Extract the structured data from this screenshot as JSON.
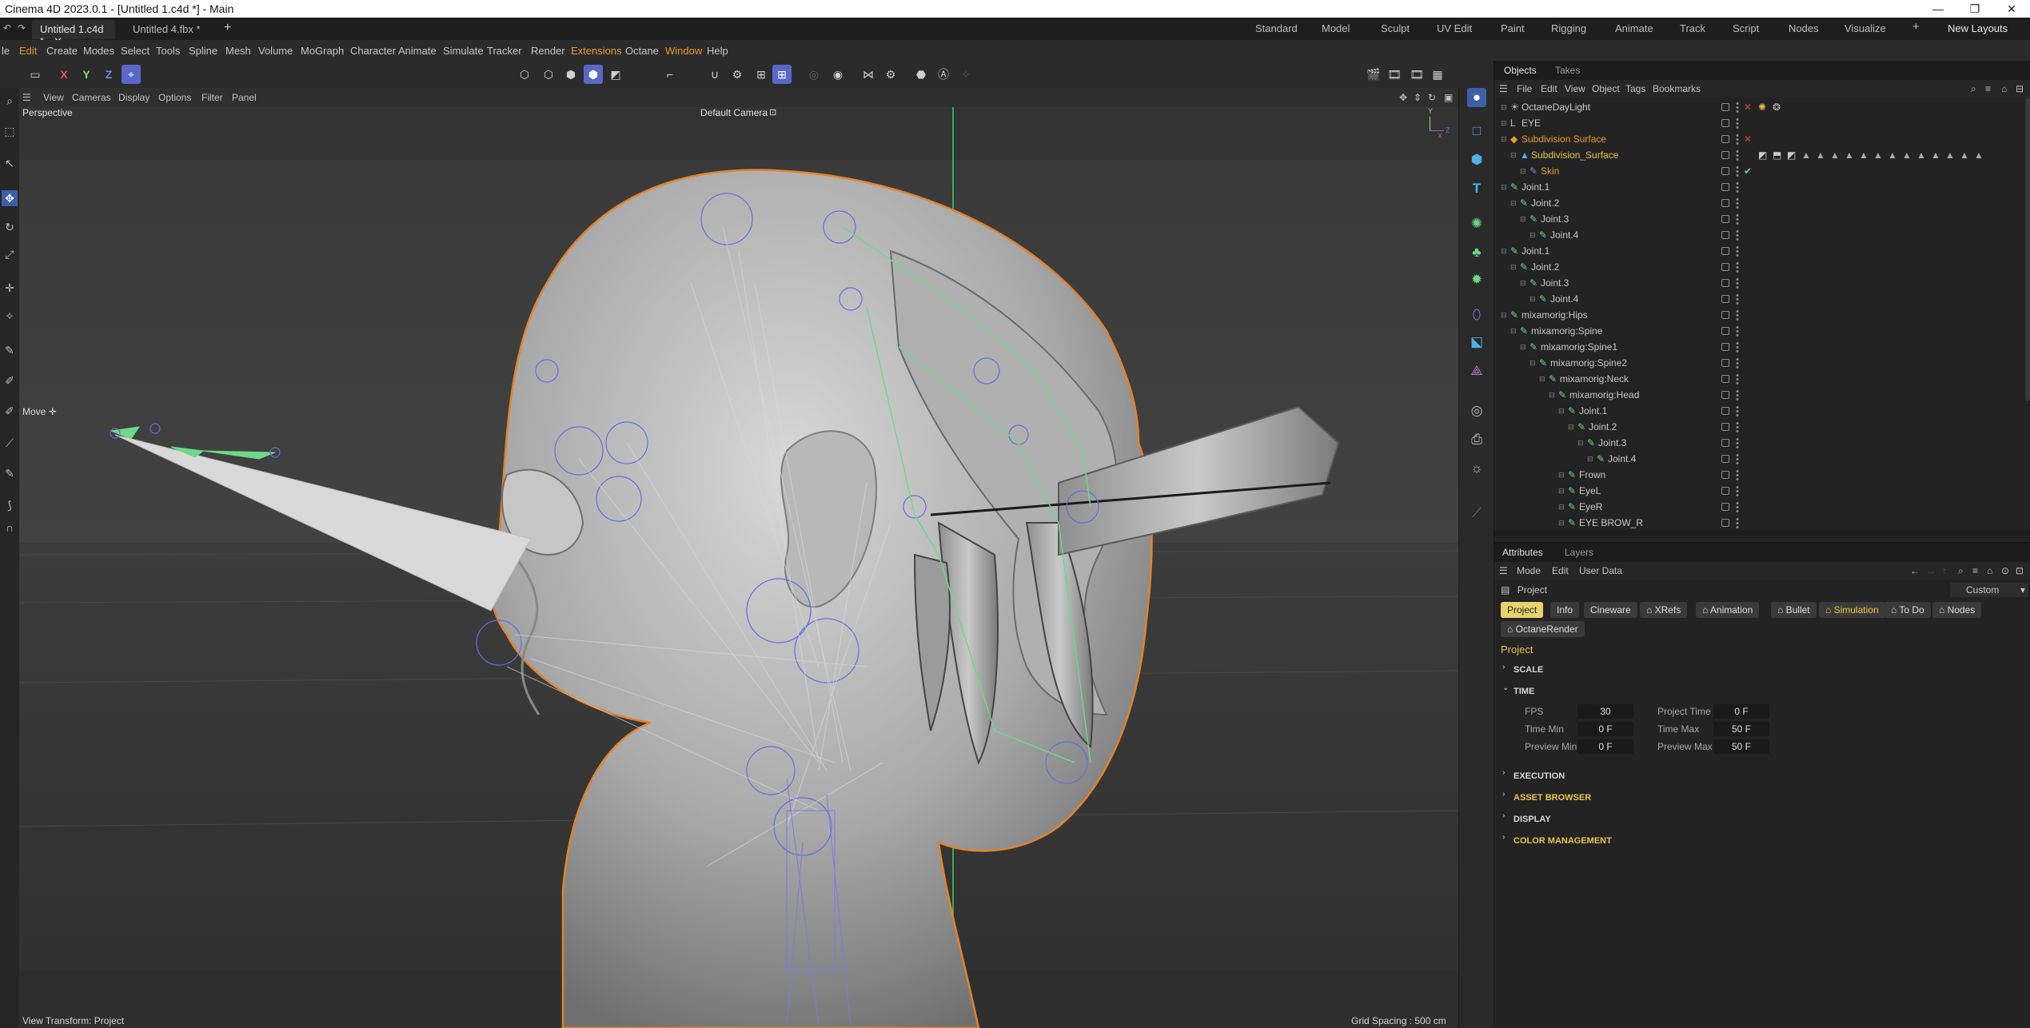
{
  "window": {
    "title": "Cinema 4D 2023.0.1 - [Untitled 1.c4d *] - Main"
  },
  "doc_tabs": [
    {
      "label": "Untitled 1.c4d *"
    },
    {
      "label": "Untitled 4.fbx *"
    }
  ],
  "add_tab": "+",
  "layouts": [
    "Standard",
    "Model",
    "Sculpt",
    "UV Edit",
    "Paint",
    "Rigging",
    "Animate",
    "Track",
    "Script",
    "Nodes",
    "Visualize"
  ],
  "new_layouts": "New Layouts",
  "menu": [
    "le",
    "Edit",
    "Create",
    "Modes",
    "Select",
    "Tools",
    "Spline",
    "Mesh",
    "Volume",
    "MoGraph",
    "Character",
    "Animate",
    "Simulate",
    "Tracker",
    "Render",
    "Extensions",
    "Octane",
    "Window",
    "Help"
  ],
  "axis_buttons": [
    "X",
    "Y",
    "Z"
  ],
  "viewport": {
    "menu": [
      "View",
      "Cameras",
      "Display",
      "Options",
      "Filter",
      "Panel"
    ],
    "name": "Perspective",
    "camera": "Default Camera",
    "tool_label": "Move",
    "view_transform": "View Transform: Project",
    "grid_spacing": "Grid Spacing : 500 cm",
    "axis": {
      "x": "X",
      "y": "Y",
      "z": "Z"
    }
  },
  "objects_panel": {
    "tabs": [
      "Objects",
      "Takes"
    ],
    "menu": [
      "File",
      "Edit",
      "View",
      "Object",
      "Tags",
      "Bookmarks"
    ],
    "rows": [
      {
        "name": "OctaneDayLight"
      },
      {
        "name": "EYE"
      },
      {
        "name": "Subdivision Surface"
      },
      {
        "name": "Subdivision_Surface"
      },
      {
        "name": "Skin"
      },
      {
        "name": "Joint.1"
      },
      {
        "name": "Joint.2"
      },
      {
        "name": "Joint.3"
      },
      {
        "name": "Joint.4"
      },
      {
        "name": "Joint.1"
      },
      {
        "name": "Joint.2"
      },
      {
        "name": "Joint.3"
      },
      {
        "name": "Joint.4"
      },
      {
        "name": "mixamorig:Hips"
      },
      {
        "name": "mixamorig:Spine"
      },
      {
        "name": "mixamorig:Spine1"
      },
      {
        "name": "mixamorig:Spine2"
      },
      {
        "name": "mixamorig:Neck"
      },
      {
        "name": "mixamorig:Head"
      },
      {
        "name": "Joint.1"
      },
      {
        "name": "Joint.2"
      },
      {
        "name": "Joint.3"
      },
      {
        "name": "Joint.4"
      },
      {
        "name": "Frown"
      },
      {
        "name": "EyeL"
      },
      {
        "name": "EyeR"
      },
      {
        "name": "EYE BROW_R"
      }
    ]
  },
  "attributes": {
    "tabs": [
      "Attributes",
      "Layers"
    ],
    "menu": [
      "Mode",
      "Edit",
      "User Data"
    ],
    "object_label": "Project",
    "preset": "Custom",
    "chips": [
      "Project",
      "Info",
      "Cineware",
      "XRefs",
      "Animation",
      "Bullet",
      "Simulation",
      "To Do",
      "Nodes",
      "OctaneRender"
    ],
    "heading": "Project",
    "sections": [
      "SCALE",
      "TIME",
      "EXECUTION",
      "ASSET BROWSER",
      "DISPLAY",
      "COLOR MANAGEMENT"
    ],
    "fields": {
      "fps_label": "FPS",
      "fps": "30",
      "project_time_label": "Project Time",
      "project_time": "0 F",
      "time_min_label": "Time Min",
      "time_min": "0 F",
      "time_max_label": "Time Max",
      "time_max": "50 F",
      "preview_min_label": "Preview Min",
      "preview_min": "0 F",
      "preview_max_label": "Preview Max",
      "preview_max": "50 F"
    }
  },
  "colors": {
    "accent": "#5b67c8",
    "orange": "#e69a2e",
    "selection_yellow": "#e8d46a",
    "bone_green": "#6dd98a"
  }
}
